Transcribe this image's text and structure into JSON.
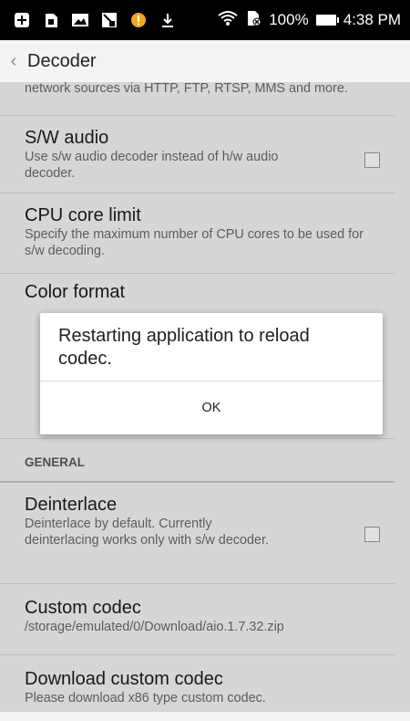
{
  "status_bar": {
    "battery": "100%",
    "time": "4:38 PM"
  },
  "app_bar": {
    "title": "Decoder"
  },
  "prefs": [
    {
      "title": "",
      "summary": "network sources via HTTP, FTP, RTSP, MMS and more."
    },
    {
      "title": "S/W audio",
      "summary": "Use s/w audio decoder instead of h/w audio decoder."
    },
    {
      "title": "CPU core limit",
      "summary": "Specify the maximum number of CPU cores to be used for s/w decoding."
    },
    {
      "title": "Color format",
      "summary": ""
    }
  ],
  "section": {
    "general": "GENERAL"
  },
  "prefs2": [
    {
      "title": "Deinterlace",
      "summary": "Deinterlace by default. Currently deinterlacing works only with s/w decoder."
    },
    {
      "title": "Custom codec",
      "summary": "/storage/emulated/0/Download/aio.1.7.32.zip"
    },
    {
      "title": "Download custom codec",
      "summary": "Please download x86 type custom codec."
    }
  ],
  "dialog": {
    "message": "Restarting application to reload codec.",
    "ok": "OK"
  }
}
